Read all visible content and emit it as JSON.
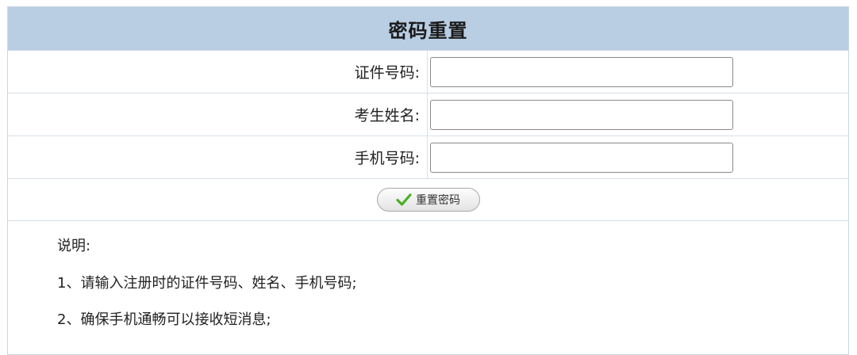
{
  "form": {
    "title": "密码重置",
    "fields": [
      {
        "label": "证件号码:",
        "value": "",
        "placeholder": ""
      },
      {
        "label": "考生姓名:",
        "value": "",
        "placeholder": ""
      },
      {
        "label": "手机号码:",
        "value": "",
        "placeholder": ""
      }
    ],
    "submit_label": "重置密码",
    "submit_icon": "check-icon"
  },
  "notes": {
    "title": "说明:",
    "items": [
      "1、请输入注册时的证件号码、姓名、手机号码;",
      "2、确保手机通畅可以接收短消息;"
    ]
  },
  "colors": {
    "header_bg": "#b9cde3",
    "border": "#c9d7e6",
    "check_green": "#4caf27"
  }
}
